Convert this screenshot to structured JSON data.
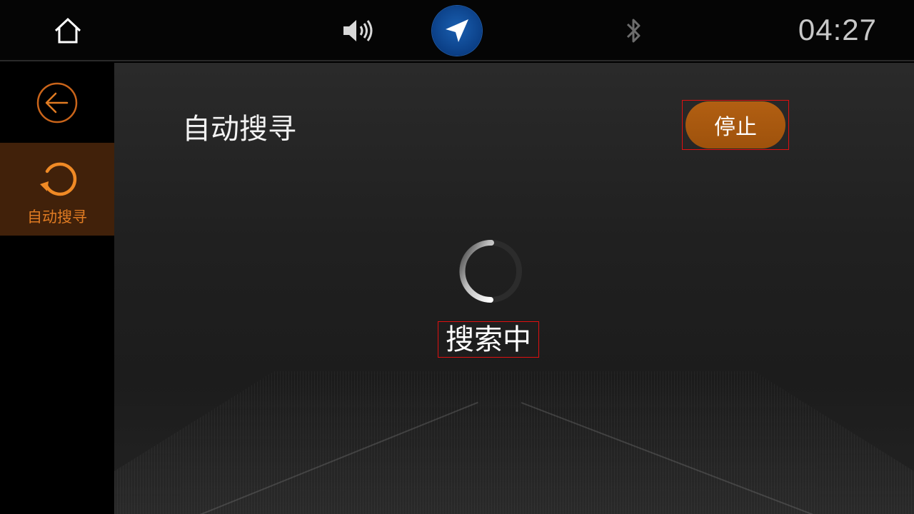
{
  "statusbar": {
    "time": "04:27",
    "icons": {
      "home": "home-icon",
      "volume": "volume-icon",
      "navigation": "navigation-arrow-icon",
      "bluetooth": "bluetooth-icon"
    }
  },
  "sidebar": {
    "back_icon": "back-arrow-icon",
    "items": [
      {
        "label": "自动搜寻",
        "icon": "refresh-icon",
        "active": true
      }
    ]
  },
  "main": {
    "title": "自动搜寻",
    "stop_label": "停止",
    "status_text": "搜索中"
  },
  "colors": {
    "accent": "#e07b22",
    "active_bg": "#41210a",
    "stop_button": "#a8570f",
    "nav_blue": "#0b3f86",
    "highlight_border": "#e01010"
  }
}
